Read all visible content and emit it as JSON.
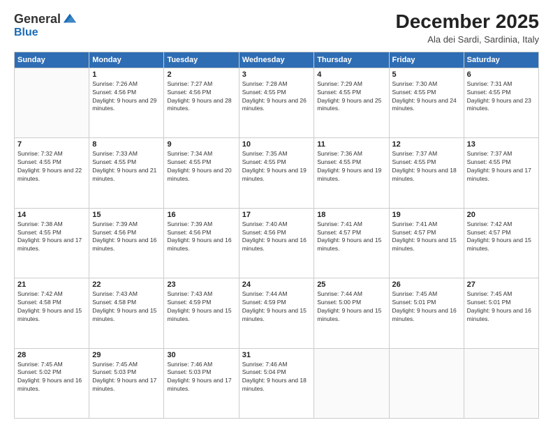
{
  "logo": {
    "general": "General",
    "blue": "Blue"
  },
  "header": {
    "month": "December 2025",
    "location": "Ala dei Sardi, Sardinia, Italy"
  },
  "days_of_week": [
    "Sunday",
    "Monday",
    "Tuesday",
    "Wednesday",
    "Thursday",
    "Friday",
    "Saturday"
  ],
  "weeks": [
    [
      {
        "day": "",
        "sunrise": "",
        "sunset": "",
        "daylight": ""
      },
      {
        "day": "1",
        "sunrise": "Sunrise: 7:26 AM",
        "sunset": "Sunset: 4:56 PM",
        "daylight": "Daylight: 9 hours and 29 minutes."
      },
      {
        "day": "2",
        "sunrise": "Sunrise: 7:27 AM",
        "sunset": "Sunset: 4:56 PM",
        "daylight": "Daylight: 9 hours and 28 minutes."
      },
      {
        "day": "3",
        "sunrise": "Sunrise: 7:28 AM",
        "sunset": "Sunset: 4:55 PM",
        "daylight": "Daylight: 9 hours and 26 minutes."
      },
      {
        "day": "4",
        "sunrise": "Sunrise: 7:29 AM",
        "sunset": "Sunset: 4:55 PM",
        "daylight": "Daylight: 9 hours and 25 minutes."
      },
      {
        "day": "5",
        "sunrise": "Sunrise: 7:30 AM",
        "sunset": "Sunset: 4:55 PM",
        "daylight": "Daylight: 9 hours and 24 minutes."
      },
      {
        "day": "6",
        "sunrise": "Sunrise: 7:31 AM",
        "sunset": "Sunset: 4:55 PM",
        "daylight": "Daylight: 9 hours and 23 minutes."
      }
    ],
    [
      {
        "day": "7",
        "sunrise": "Sunrise: 7:32 AM",
        "sunset": "Sunset: 4:55 PM",
        "daylight": "Daylight: 9 hours and 22 minutes."
      },
      {
        "day": "8",
        "sunrise": "Sunrise: 7:33 AM",
        "sunset": "Sunset: 4:55 PM",
        "daylight": "Daylight: 9 hours and 21 minutes."
      },
      {
        "day": "9",
        "sunrise": "Sunrise: 7:34 AM",
        "sunset": "Sunset: 4:55 PM",
        "daylight": "Daylight: 9 hours and 20 minutes."
      },
      {
        "day": "10",
        "sunrise": "Sunrise: 7:35 AM",
        "sunset": "Sunset: 4:55 PM",
        "daylight": "Daylight: 9 hours and 19 minutes."
      },
      {
        "day": "11",
        "sunrise": "Sunrise: 7:36 AM",
        "sunset": "Sunset: 4:55 PM",
        "daylight": "Daylight: 9 hours and 19 minutes."
      },
      {
        "day": "12",
        "sunrise": "Sunrise: 7:37 AM",
        "sunset": "Sunset: 4:55 PM",
        "daylight": "Daylight: 9 hours and 18 minutes."
      },
      {
        "day": "13",
        "sunrise": "Sunrise: 7:37 AM",
        "sunset": "Sunset: 4:55 PM",
        "daylight": "Daylight: 9 hours and 17 minutes."
      }
    ],
    [
      {
        "day": "14",
        "sunrise": "Sunrise: 7:38 AM",
        "sunset": "Sunset: 4:55 PM",
        "daylight": "Daylight: 9 hours and 17 minutes."
      },
      {
        "day": "15",
        "sunrise": "Sunrise: 7:39 AM",
        "sunset": "Sunset: 4:56 PM",
        "daylight": "Daylight: 9 hours and 16 minutes."
      },
      {
        "day": "16",
        "sunrise": "Sunrise: 7:39 AM",
        "sunset": "Sunset: 4:56 PM",
        "daylight": "Daylight: 9 hours and 16 minutes."
      },
      {
        "day": "17",
        "sunrise": "Sunrise: 7:40 AM",
        "sunset": "Sunset: 4:56 PM",
        "daylight": "Daylight: 9 hours and 16 minutes."
      },
      {
        "day": "18",
        "sunrise": "Sunrise: 7:41 AM",
        "sunset": "Sunset: 4:57 PM",
        "daylight": "Daylight: 9 hours and 15 minutes."
      },
      {
        "day": "19",
        "sunrise": "Sunrise: 7:41 AM",
        "sunset": "Sunset: 4:57 PM",
        "daylight": "Daylight: 9 hours and 15 minutes."
      },
      {
        "day": "20",
        "sunrise": "Sunrise: 7:42 AM",
        "sunset": "Sunset: 4:57 PM",
        "daylight": "Daylight: 9 hours and 15 minutes."
      }
    ],
    [
      {
        "day": "21",
        "sunrise": "Sunrise: 7:42 AM",
        "sunset": "Sunset: 4:58 PM",
        "daylight": "Daylight: 9 hours and 15 minutes."
      },
      {
        "day": "22",
        "sunrise": "Sunrise: 7:43 AM",
        "sunset": "Sunset: 4:58 PM",
        "daylight": "Daylight: 9 hours and 15 minutes."
      },
      {
        "day": "23",
        "sunrise": "Sunrise: 7:43 AM",
        "sunset": "Sunset: 4:59 PM",
        "daylight": "Daylight: 9 hours and 15 minutes."
      },
      {
        "day": "24",
        "sunrise": "Sunrise: 7:44 AM",
        "sunset": "Sunset: 4:59 PM",
        "daylight": "Daylight: 9 hours and 15 minutes."
      },
      {
        "day": "25",
        "sunrise": "Sunrise: 7:44 AM",
        "sunset": "Sunset: 5:00 PM",
        "daylight": "Daylight: 9 hours and 15 minutes."
      },
      {
        "day": "26",
        "sunrise": "Sunrise: 7:45 AM",
        "sunset": "Sunset: 5:01 PM",
        "daylight": "Daylight: 9 hours and 16 minutes."
      },
      {
        "day": "27",
        "sunrise": "Sunrise: 7:45 AM",
        "sunset": "Sunset: 5:01 PM",
        "daylight": "Daylight: 9 hours and 16 minutes."
      }
    ],
    [
      {
        "day": "28",
        "sunrise": "Sunrise: 7:45 AM",
        "sunset": "Sunset: 5:02 PM",
        "daylight": "Daylight: 9 hours and 16 minutes."
      },
      {
        "day": "29",
        "sunrise": "Sunrise: 7:45 AM",
        "sunset": "Sunset: 5:03 PM",
        "daylight": "Daylight: 9 hours and 17 minutes."
      },
      {
        "day": "30",
        "sunrise": "Sunrise: 7:46 AM",
        "sunset": "Sunset: 5:03 PM",
        "daylight": "Daylight: 9 hours and 17 minutes."
      },
      {
        "day": "31",
        "sunrise": "Sunrise: 7:46 AM",
        "sunset": "Sunset: 5:04 PM",
        "daylight": "Daylight: 9 hours and 18 minutes."
      },
      {
        "day": "",
        "sunrise": "",
        "sunset": "",
        "daylight": ""
      },
      {
        "day": "",
        "sunrise": "",
        "sunset": "",
        "daylight": ""
      },
      {
        "day": "",
        "sunrise": "",
        "sunset": "",
        "daylight": ""
      }
    ]
  ]
}
